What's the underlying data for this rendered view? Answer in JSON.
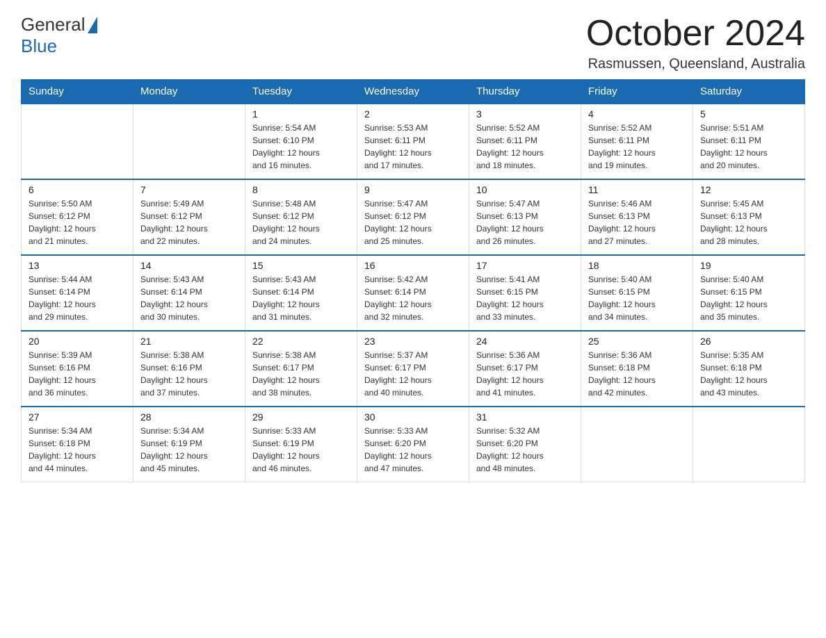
{
  "logo": {
    "word1": "General",
    "word2": "Blue"
  },
  "header": {
    "month_year": "October 2024",
    "location": "Rasmussen, Queensland, Australia"
  },
  "weekdays": [
    "Sunday",
    "Monday",
    "Tuesday",
    "Wednesday",
    "Thursday",
    "Friday",
    "Saturday"
  ],
  "weeks": [
    [
      {
        "day": "",
        "info": ""
      },
      {
        "day": "",
        "info": ""
      },
      {
        "day": "1",
        "info": "Sunrise: 5:54 AM\nSunset: 6:10 PM\nDaylight: 12 hours\nand 16 minutes."
      },
      {
        "day": "2",
        "info": "Sunrise: 5:53 AM\nSunset: 6:11 PM\nDaylight: 12 hours\nand 17 minutes."
      },
      {
        "day": "3",
        "info": "Sunrise: 5:52 AM\nSunset: 6:11 PM\nDaylight: 12 hours\nand 18 minutes."
      },
      {
        "day": "4",
        "info": "Sunrise: 5:52 AM\nSunset: 6:11 PM\nDaylight: 12 hours\nand 19 minutes."
      },
      {
        "day": "5",
        "info": "Sunrise: 5:51 AM\nSunset: 6:11 PM\nDaylight: 12 hours\nand 20 minutes."
      }
    ],
    [
      {
        "day": "6",
        "info": "Sunrise: 5:50 AM\nSunset: 6:12 PM\nDaylight: 12 hours\nand 21 minutes."
      },
      {
        "day": "7",
        "info": "Sunrise: 5:49 AM\nSunset: 6:12 PM\nDaylight: 12 hours\nand 22 minutes."
      },
      {
        "day": "8",
        "info": "Sunrise: 5:48 AM\nSunset: 6:12 PM\nDaylight: 12 hours\nand 24 minutes."
      },
      {
        "day": "9",
        "info": "Sunrise: 5:47 AM\nSunset: 6:12 PM\nDaylight: 12 hours\nand 25 minutes."
      },
      {
        "day": "10",
        "info": "Sunrise: 5:47 AM\nSunset: 6:13 PM\nDaylight: 12 hours\nand 26 minutes."
      },
      {
        "day": "11",
        "info": "Sunrise: 5:46 AM\nSunset: 6:13 PM\nDaylight: 12 hours\nand 27 minutes."
      },
      {
        "day": "12",
        "info": "Sunrise: 5:45 AM\nSunset: 6:13 PM\nDaylight: 12 hours\nand 28 minutes."
      }
    ],
    [
      {
        "day": "13",
        "info": "Sunrise: 5:44 AM\nSunset: 6:14 PM\nDaylight: 12 hours\nand 29 minutes."
      },
      {
        "day": "14",
        "info": "Sunrise: 5:43 AM\nSunset: 6:14 PM\nDaylight: 12 hours\nand 30 minutes."
      },
      {
        "day": "15",
        "info": "Sunrise: 5:43 AM\nSunset: 6:14 PM\nDaylight: 12 hours\nand 31 minutes."
      },
      {
        "day": "16",
        "info": "Sunrise: 5:42 AM\nSunset: 6:14 PM\nDaylight: 12 hours\nand 32 minutes."
      },
      {
        "day": "17",
        "info": "Sunrise: 5:41 AM\nSunset: 6:15 PM\nDaylight: 12 hours\nand 33 minutes."
      },
      {
        "day": "18",
        "info": "Sunrise: 5:40 AM\nSunset: 6:15 PM\nDaylight: 12 hours\nand 34 minutes."
      },
      {
        "day": "19",
        "info": "Sunrise: 5:40 AM\nSunset: 6:15 PM\nDaylight: 12 hours\nand 35 minutes."
      }
    ],
    [
      {
        "day": "20",
        "info": "Sunrise: 5:39 AM\nSunset: 6:16 PM\nDaylight: 12 hours\nand 36 minutes."
      },
      {
        "day": "21",
        "info": "Sunrise: 5:38 AM\nSunset: 6:16 PM\nDaylight: 12 hours\nand 37 minutes."
      },
      {
        "day": "22",
        "info": "Sunrise: 5:38 AM\nSunset: 6:17 PM\nDaylight: 12 hours\nand 38 minutes."
      },
      {
        "day": "23",
        "info": "Sunrise: 5:37 AM\nSunset: 6:17 PM\nDaylight: 12 hours\nand 40 minutes."
      },
      {
        "day": "24",
        "info": "Sunrise: 5:36 AM\nSunset: 6:17 PM\nDaylight: 12 hours\nand 41 minutes."
      },
      {
        "day": "25",
        "info": "Sunrise: 5:36 AM\nSunset: 6:18 PM\nDaylight: 12 hours\nand 42 minutes."
      },
      {
        "day": "26",
        "info": "Sunrise: 5:35 AM\nSunset: 6:18 PM\nDaylight: 12 hours\nand 43 minutes."
      }
    ],
    [
      {
        "day": "27",
        "info": "Sunrise: 5:34 AM\nSunset: 6:18 PM\nDaylight: 12 hours\nand 44 minutes."
      },
      {
        "day": "28",
        "info": "Sunrise: 5:34 AM\nSunset: 6:19 PM\nDaylight: 12 hours\nand 45 minutes."
      },
      {
        "day": "29",
        "info": "Sunrise: 5:33 AM\nSunset: 6:19 PM\nDaylight: 12 hours\nand 46 minutes."
      },
      {
        "day": "30",
        "info": "Sunrise: 5:33 AM\nSunset: 6:20 PM\nDaylight: 12 hours\nand 47 minutes."
      },
      {
        "day": "31",
        "info": "Sunrise: 5:32 AM\nSunset: 6:20 PM\nDaylight: 12 hours\nand 48 minutes."
      },
      {
        "day": "",
        "info": ""
      },
      {
        "day": "",
        "info": ""
      }
    ]
  ]
}
